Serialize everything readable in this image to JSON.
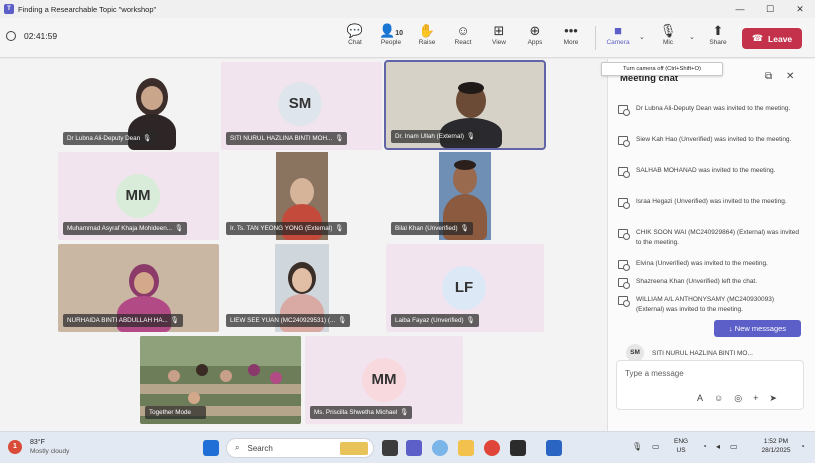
{
  "window": {
    "title": "Finding a Researchable Topic \"workshop\"",
    "minimize": "—",
    "maximize": "☐",
    "close": "✕"
  },
  "toolbar": {
    "timer": "02:41:59",
    "chat": "Chat",
    "people": "People",
    "people_count": "10",
    "raise": "Raise",
    "react": "React",
    "view": "View",
    "apps": "Apps",
    "more": "More",
    "camera": "Camera",
    "mic": "Mic",
    "share": "Share",
    "leave": "Leave"
  },
  "tooltip": "Turn camera off (Ctrl+Shift+O)",
  "participants": [
    {
      "name": "Dr Lubna Ali-Deputy Dean"
    },
    {
      "name": "SITI NURUL HAZLINA BINTI MOH...",
      "initials": "SM"
    },
    {
      "name": "Dr. Inam Ullah (External)"
    },
    {
      "name": "Muhammad Asyraf Khaja Mohideen...",
      "initials": "MM"
    },
    {
      "name": "Ir. Ts. TAN YEONG YONG (External)"
    },
    {
      "name": "Bilal Khan (Unverified)"
    },
    {
      "name": "NURHAIDA BINTI ABDULLAH HA..."
    },
    {
      "name": "LIEW SEE YUAN (MC240929531) (..."
    },
    {
      "name": "Laiba Fayaz (Unverified)",
      "initials": "LF"
    },
    {
      "name": "Together Mode"
    },
    {
      "name": "Ms. Priscilla Shwetha Michael",
      "initials": "MM"
    }
  ],
  "chat": {
    "title": "Meeting chat",
    "messages": [
      "Dr Lubna Ali-Deputy Dean was invited to the meeting.",
      "Siew Kah Hao (Unverified) was invited to the meeting.",
      "SALHAB MOHANAD was invited to the meeting.",
      "Israa Hegazi (Unverified) was invited to the meeting.",
      "CHIK SOON WAI (MC240929864) (External) was invited to the meeting.",
      "Elvina (Unverified) was invited to the meeting.",
      "Shazreena Khan (Unverified) left the chat.",
      "WILLIAM A/L ANTHONYSAMY (MC240930093) (External) was invited to the meeting."
    ],
    "new_messages": "New messages",
    "sender_initials": "SM",
    "sender_name": "SITI NURUL HAZLINA BINTI MO...",
    "compose_placeholder": "Type a message"
  },
  "taskbar": {
    "weather_badge": "1",
    "temperature": "83°F",
    "condition": "Mostly cloudy",
    "search": "Search",
    "lang": "ENG",
    "region": "US",
    "time": "1:52 PM",
    "date": "28/1/2025"
  }
}
